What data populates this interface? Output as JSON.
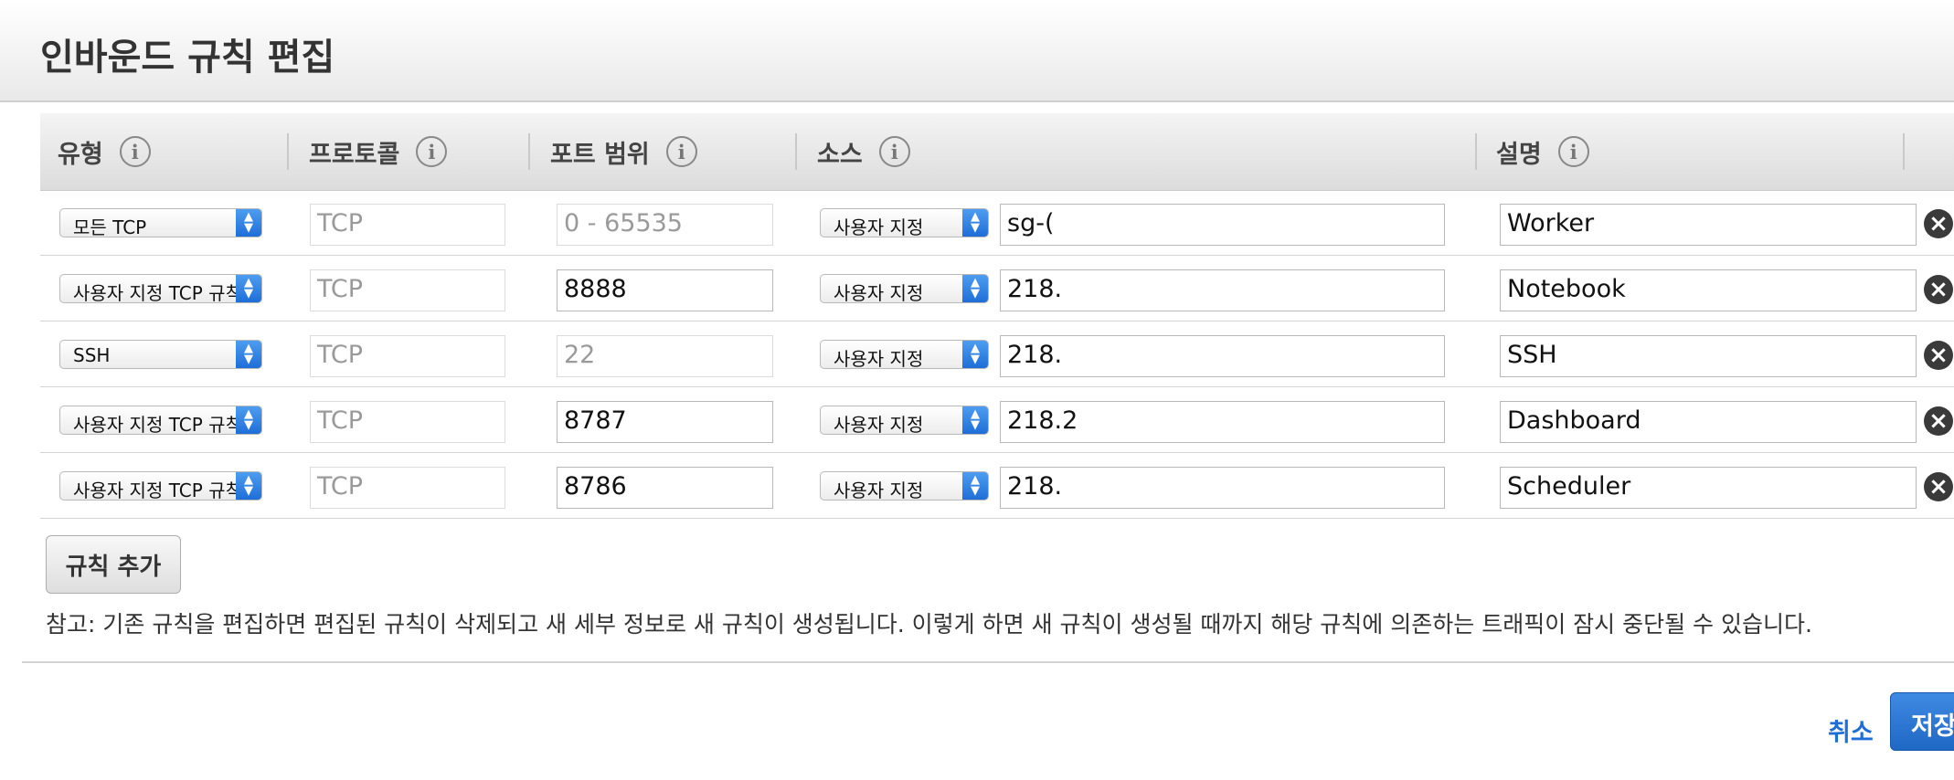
{
  "modal": {
    "title": "인바운드 규칙 편집"
  },
  "table": {
    "columns": [
      {
        "label": "유형"
      },
      {
        "label": "프로토콜"
      },
      {
        "label": "포트 범위"
      },
      {
        "label": "소스"
      },
      {
        "label": "설명"
      }
    ],
    "rows": [
      {
        "type": "모든 TCP",
        "protocol": "TCP",
        "port": "0 - 65535",
        "port_disabled": true,
        "source_mode": "사용자 지정",
        "source": "sg-(",
        "description": "Worker"
      },
      {
        "type": "사용자 지정 TCP 규칙",
        "protocol": "TCP",
        "port": "8888",
        "port_disabled": false,
        "source_mode": "사용자 지정",
        "source": "218.",
        "description": "Notebook"
      },
      {
        "type": "SSH",
        "protocol": "TCP",
        "port": "22",
        "port_disabled": true,
        "source_mode": "사용자 지정",
        "source": "218.",
        "description": "SSH"
      },
      {
        "type": "사용자 지정 TCP 규칙",
        "protocol": "TCP",
        "port": "8787",
        "port_disabled": false,
        "source_mode": "사용자 지정",
        "source": "218.2",
        "description": "Dashboard"
      },
      {
        "type": "사용자 지정 TCP 규칙",
        "protocol": "TCP",
        "port": "8786",
        "port_disabled": false,
        "source_mode": "사용자 지정",
        "source": "218.",
        "description": "Scheduler"
      }
    ]
  },
  "actions": {
    "add_rule_label": "규칙 추가",
    "note": "참고: 기존 규칙을 편집하면 편집된 규칙이 삭제되고 새 세부 정보로 새 규칙이 생성됩니다. 이렇게 하면 새 규칙이 생성될 때까지 해당 규칙에 의존하는 트래픽이 잠시 중단될 수 있습니다.",
    "cancel_label": "취소",
    "save_label": "저장"
  },
  "icons": {
    "info": "info-icon",
    "select_arrow": "chevron-updown-icon",
    "remove": "close-circle-icon"
  },
  "colors": {
    "accent": "#1f6ed8",
    "remove_icon": "#3a3a3a"
  }
}
